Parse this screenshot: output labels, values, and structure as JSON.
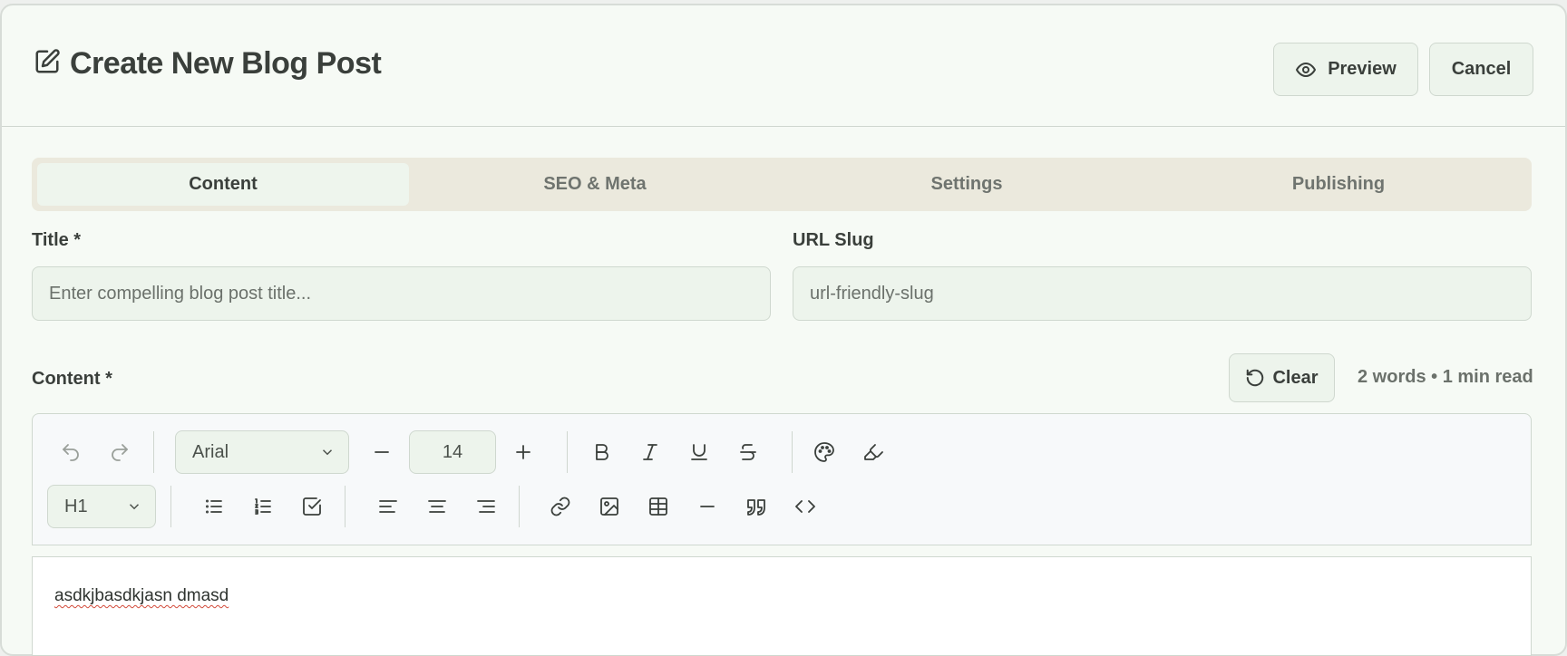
{
  "header": {
    "title": "Create New Blog Post",
    "title_icon": "pencil-square-icon",
    "preview_label": "Preview",
    "cancel_label": "Cancel"
  },
  "tabs": [
    {
      "label": "Content",
      "active": true
    },
    {
      "label": "SEO & Meta",
      "active": false
    },
    {
      "label": "Settings",
      "active": false
    },
    {
      "label": "Publishing",
      "active": false
    }
  ],
  "form": {
    "title_label": "Title *",
    "title_placeholder": "Enter compelling blog post title...",
    "slug_label": "URL Slug",
    "slug_placeholder": "url-friendly-slug",
    "content_label": "Content *",
    "clear_label": "Clear",
    "word_count": "2 words • 1 min read"
  },
  "toolbar": {
    "font_family": "Arial",
    "font_size": "14",
    "heading": "H1",
    "icons": [
      "undo-icon",
      "redo-icon",
      "minus-icon",
      "plus-icon",
      "bold-icon",
      "italic-icon",
      "underline-icon",
      "strikethrough-icon",
      "palette-icon",
      "highlighter-icon",
      "bullet-list-icon",
      "numbered-list-icon",
      "checklist-icon",
      "align-left-icon",
      "align-center-icon",
      "align-right-icon",
      "link-icon",
      "image-icon",
      "table-icon",
      "horizontal-rule-icon",
      "quote-icon",
      "code-icon"
    ]
  },
  "editor": {
    "text": "asdkjbasdkjasn dmasd"
  },
  "colors": {
    "background": "#f6faf5",
    "input_bg": "#edf4ec",
    "tab_bar_bg": "#ebe9dd",
    "text": "#3a3f3b",
    "spellcheck": "#d24a3a"
  }
}
